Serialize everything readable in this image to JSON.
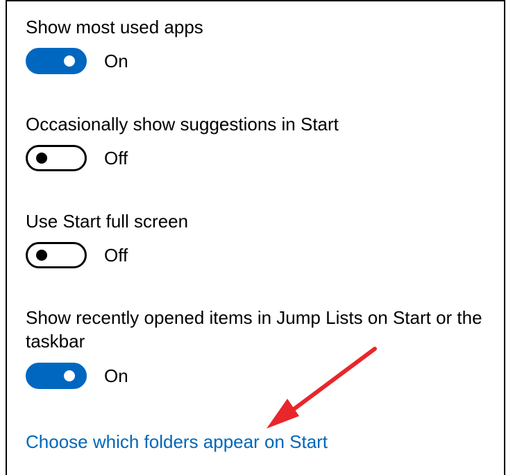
{
  "settings": [
    {
      "label": "Show most used apps",
      "state": "On",
      "on": true
    },
    {
      "label": "Occasionally show suggestions in Start",
      "state": "Off",
      "on": false
    },
    {
      "label": "Use Start full screen",
      "state": "Off",
      "on": false
    },
    {
      "label": "Show recently opened items in Jump Lists on Start or the taskbar",
      "state": "On",
      "on": true
    }
  ],
  "link": {
    "label": "Choose which folders appear on Start"
  },
  "colors": {
    "toggle_on": "#0067c0",
    "link": "#0067b8",
    "annotation_arrow": "#e8262b"
  },
  "annotation": {
    "icon": "red-arrow-icon"
  }
}
